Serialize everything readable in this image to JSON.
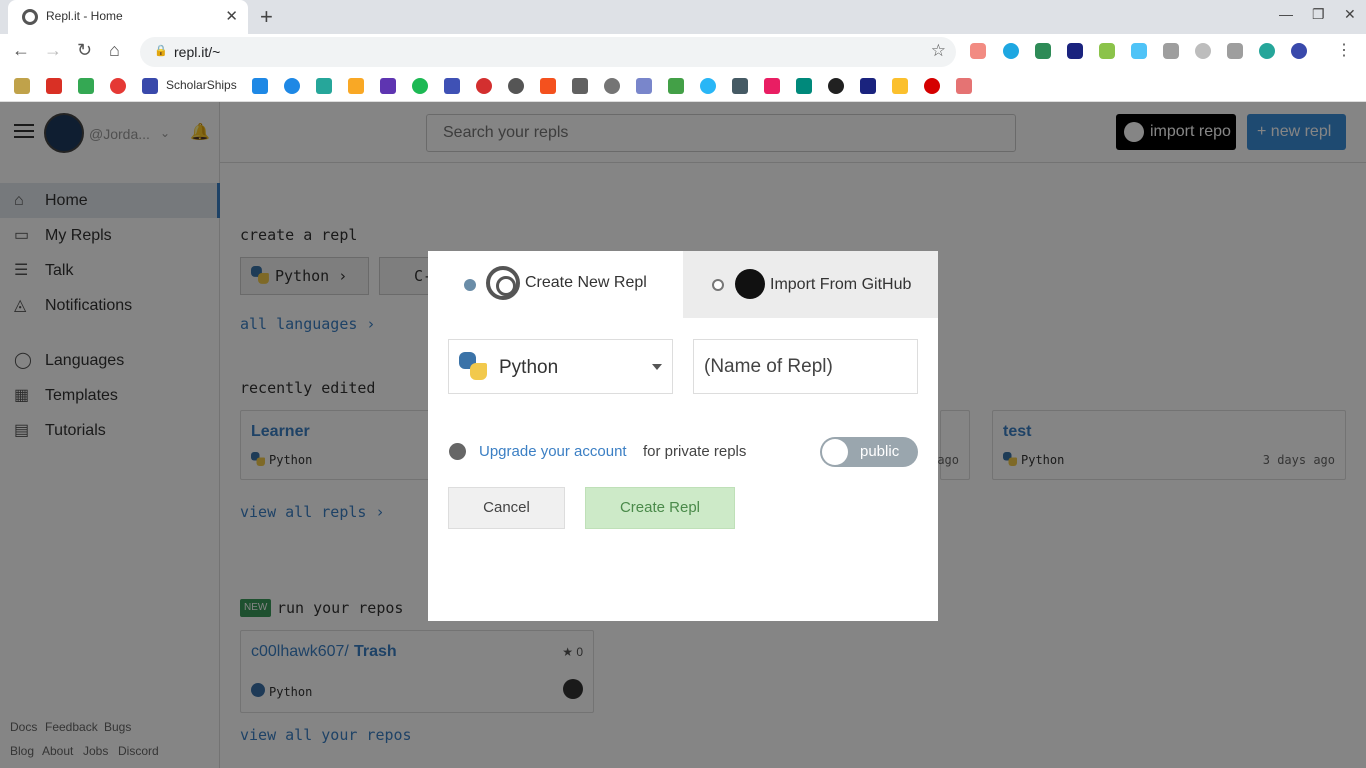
{
  "browser": {
    "tab_title": "Repl.it - Home",
    "url": "repl.it/~",
    "bookmark_label": "ScholarShips"
  },
  "sidebar": {
    "username": "@Jorda...",
    "items": [
      {
        "label": "Home",
        "icon": "home-icon"
      },
      {
        "label": "My Repls",
        "icon": "folder-icon"
      },
      {
        "label": "Talk",
        "icon": "list-icon"
      },
      {
        "label": "Notifications",
        "icon": "bell-icon"
      },
      {
        "label": "Languages",
        "icon": "globe-icon"
      },
      {
        "label": "Templates",
        "icon": "grid-icon"
      },
      {
        "label": "Tutorials",
        "icon": "book-icon"
      }
    ],
    "footer_links": [
      "Docs",
      "Feedback",
      "Bugs",
      "Blog",
      "About",
      "Jobs",
      "Discord"
    ]
  },
  "header": {
    "search_placeholder": "Search your repls",
    "import_repo": "import repo",
    "new_repl": "+ new repl"
  },
  "main": {
    "create_title": "create a repl",
    "lang_python": "Python ›",
    "lang_c": "C-",
    "all_languages": "all languages ›",
    "recent_title": "recently edited",
    "recent": [
      {
        "title": "Learner",
        "lang": "Python",
        "time": ""
      },
      {
        "title": "",
        "lang": "",
        "time": "ago"
      },
      {
        "title": "test",
        "lang": "Python",
        "time": "3 days ago"
      }
    ],
    "view_all_repls": "view all repls ›",
    "new_badge": "NEW",
    "repos_title": "run your repos",
    "repo": {
      "owner": "c00lhawk607/",
      "name": "Trash",
      "stars": "★ 0",
      "lang": "Python"
    },
    "view_all_repos": "view all your repos"
  },
  "modal": {
    "tab_new": "Create New Repl",
    "tab_github": "Import From GitHub",
    "language": "Python",
    "name_placeholder": "(Name of Repl)",
    "upgrade_link": "Upgrade your account",
    "upgrade_rest": "for private repls",
    "visibility": "public",
    "cancel": "Cancel",
    "create": "Create Repl"
  },
  "colors": {
    "accent": "#3b7fc4",
    "new_repl": "#3b8ed8",
    "create_button": "#cdeac8",
    "overlay": "rgba(0,0,0,0.48)"
  }
}
